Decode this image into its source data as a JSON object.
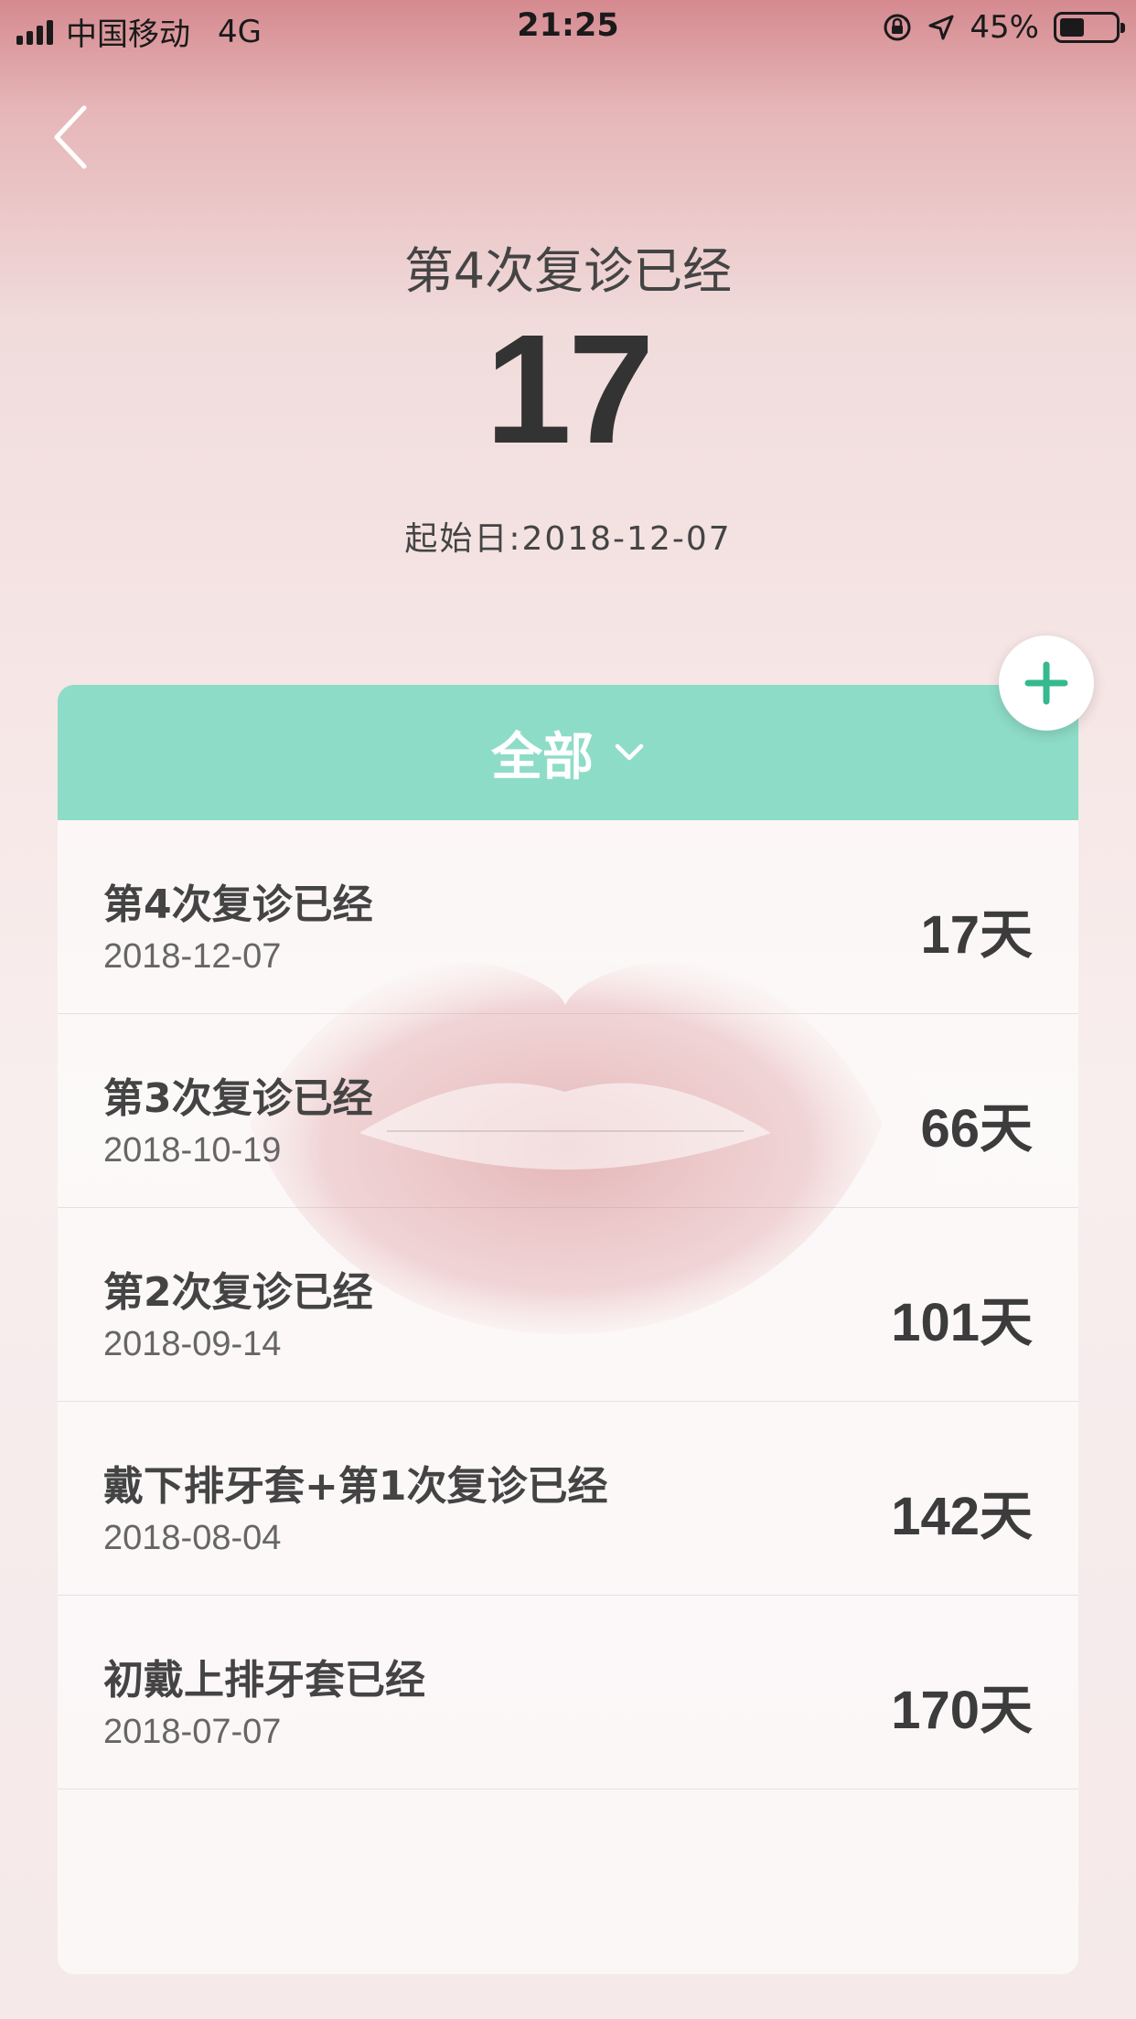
{
  "status_bar": {
    "carrier": "中国移动",
    "network": "4G",
    "time": "21:25",
    "battery": "45%",
    "battery_level": 0.45
  },
  "nav": {
    "back_icon": "chevron-left-icon"
  },
  "header": {
    "title": "第4次复诊已经",
    "count": "17",
    "start_date": "起始日:2018-12-07"
  },
  "filter": {
    "label": "全部",
    "icon": "chevron-down-icon"
  },
  "add_button": {
    "icon": "plus-icon"
  },
  "records": [
    {
      "title": "第4次复诊已经",
      "date": "2018-12-07",
      "days": "17天"
    },
    {
      "title": "第3次复诊已经",
      "date": "2018-10-19",
      "days": "66天"
    },
    {
      "title": "第2次复诊已经",
      "date": "2018-09-14",
      "days": "101天"
    },
    {
      "title": "戴下排牙套+第1次复诊已经",
      "date": "2018-08-04",
      "days": "142天"
    },
    {
      "title": "初戴上排牙套已经",
      "date": "2018-07-07",
      "days": "170天"
    }
  ],
  "colors": {
    "accent": "#8ddcc7",
    "plus": "#35b98f",
    "text_dark": "#333333"
  }
}
